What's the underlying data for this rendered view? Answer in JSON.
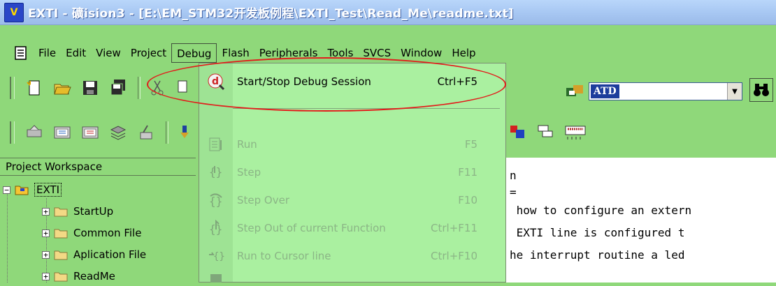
{
  "window": {
    "title": "EXTI  - 礦ision3 - [E:\\EM_STM32开发板例程\\EXTI_Test\\Read_Me\\readme.txt]",
    "icon_text": "V"
  },
  "menu": {
    "items": [
      "File",
      "Edit",
      "View",
      "Project",
      "Debug",
      "Flash",
      "Peripherals",
      "Tools",
      "SVCS",
      "Window",
      "Help"
    ],
    "active": "Debug"
  },
  "toolbar": {
    "target_combo": "ATD"
  },
  "workspace": {
    "header": "Project Workspace",
    "root": "EXTI",
    "groups": [
      "StartUp",
      "Common File",
      "Aplication File",
      "ReadMe"
    ]
  },
  "debug_menu": {
    "start_stop": {
      "label": "Start/Stop Debug Session",
      "shortcut": "Ctrl+F5"
    },
    "items": [
      {
        "label": "Run",
        "shortcut": "F5"
      },
      {
        "label": "Step",
        "shortcut": "F11"
      },
      {
        "label": "Step Over",
        "shortcut": "F10"
      },
      {
        "label": "Step Out of current Function",
        "shortcut": "Ctrl+F11"
      },
      {
        "label": "Run to Cursor line",
        "shortcut": "Ctrl+F10"
      }
    ]
  },
  "editor": {
    "lines": [
      "n",
      "=",
      " how to configure an extern",
      " EXTI line is configured t",
      "he interrupt routine a led"
    ]
  },
  "colors": {
    "background": "#8fd87a",
    "menu_background": "#aaf0a0",
    "highlight_ellipse": "#e31b1b",
    "title_text": "#ffffff"
  }
}
